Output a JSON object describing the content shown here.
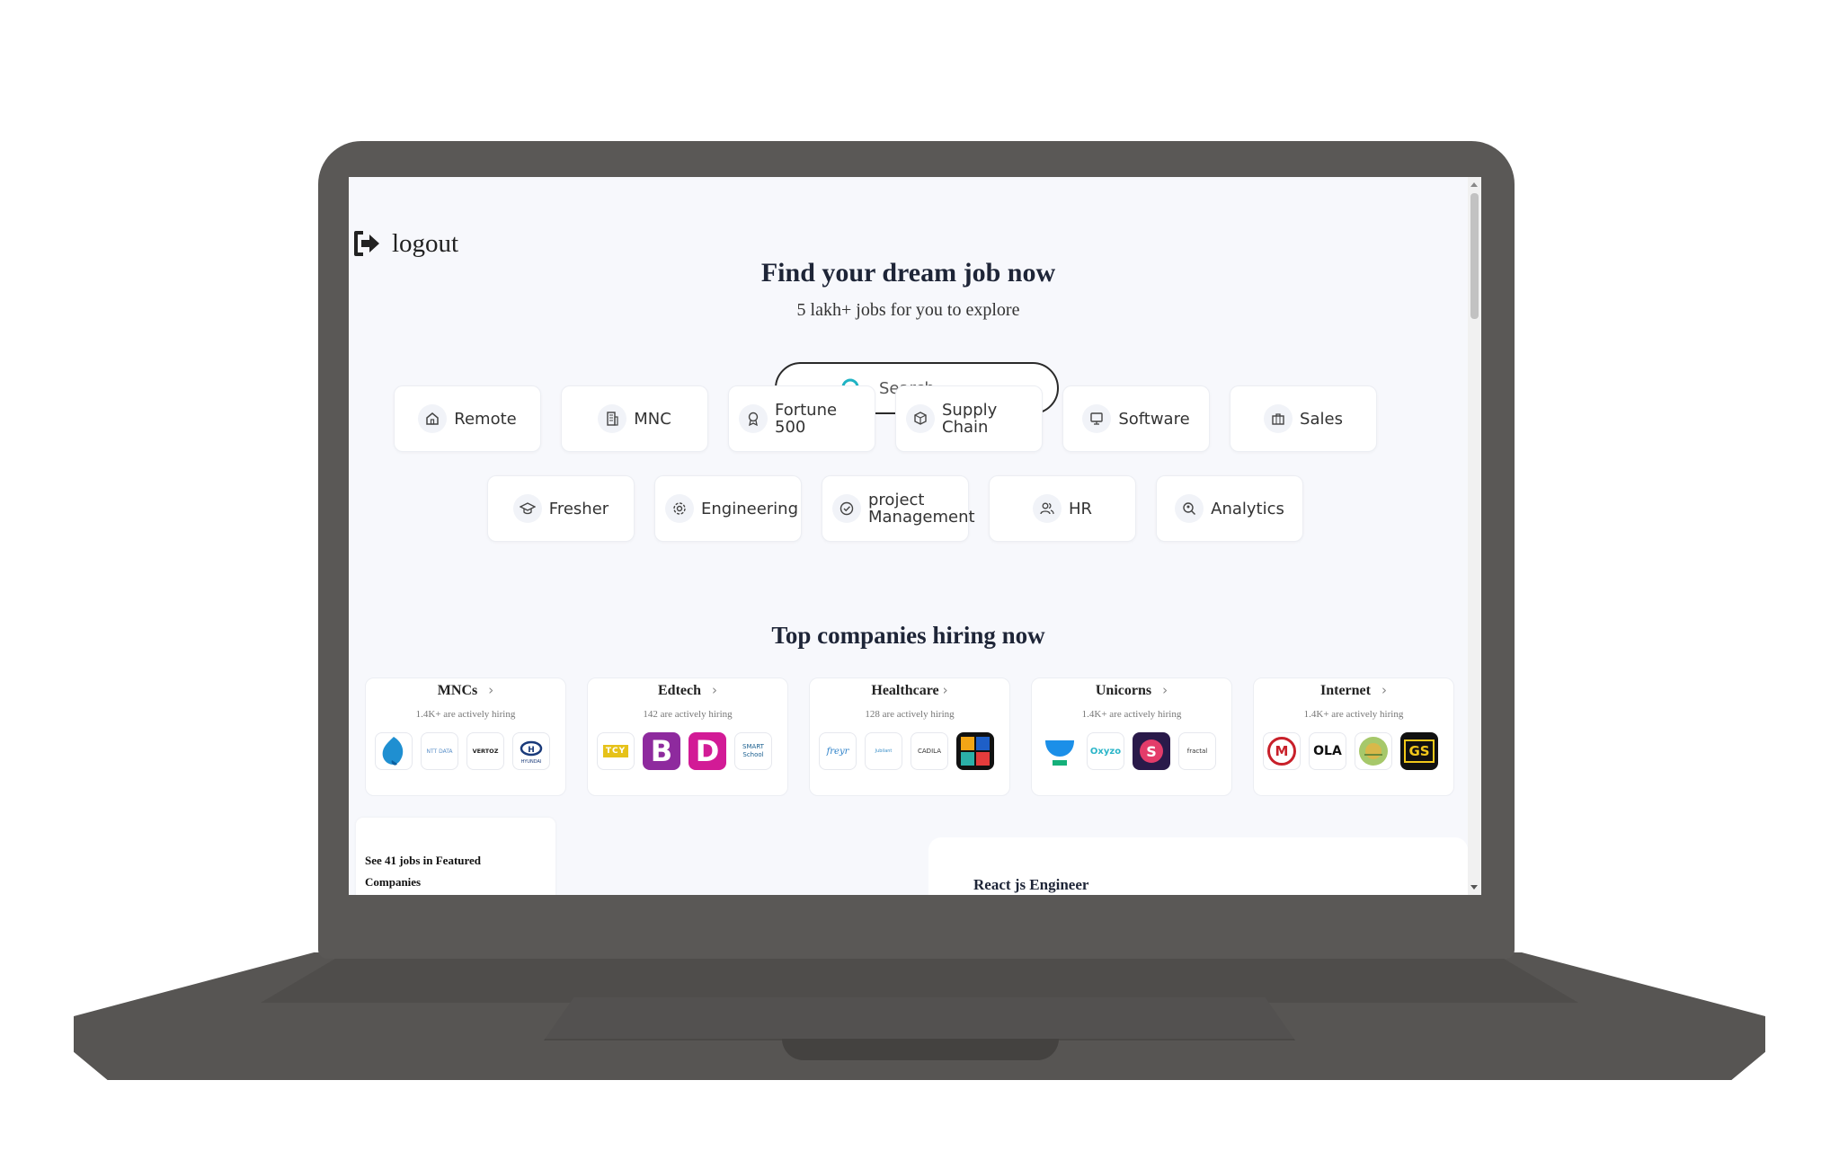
{
  "header": {
    "logout_label": "logout"
  },
  "hero": {
    "title": "Find your dream job now",
    "subtitle": "5 lakh+ jobs for you to explore",
    "search_placeholder": "Search"
  },
  "categories": [
    {
      "label": "Remote",
      "icon": "home-icon"
    },
    {
      "label": "MNC",
      "icon": "building-icon"
    },
    {
      "label": "Fortune 500",
      "icon": "award-icon"
    },
    {
      "label": "Supply Chain",
      "icon": "box-icon"
    },
    {
      "label": "Software",
      "icon": "monitor-icon"
    },
    {
      "label": "Sales",
      "icon": "briefcase-icon"
    },
    {
      "label": "Fresher",
      "icon": "graduation-cap-icon"
    },
    {
      "label": "Engineering",
      "icon": "gear-icon"
    },
    {
      "label": "project Management",
      "icon": "check-circle-icon"
    },
    {
      "label": "HR",
      "icon": "users-icon"
    },
    {
      "label": "Analytics",
      "icon": "analytics-icon"
    }
  ],
  "top_companies": {
    "title": "Top companies hiring now",
    "cards": [
      {
        "name": "MNCs",
        "subtitle": "1.4K+ are actively hiring",
        "logos": [
          "leaf-logo",
          "NTT DATA",
          "VERTOZ",
          "HYUNDAI"
        ]
      },
      {
        "name": "Edtech",
        "subtitle": "142 are actively hiring",
        "logos": [
          "TCY",
          "B",
          "D",
          "SMART School"
        ]
      },
      {
        "name": "Healthcare",
        "subtitle": "128 are actively hiring",
        "logos": [
          "freyr",
          "Jubilant",
          "CADILA",
          "cubes-logo"
        ]
      },
      {
        "name": "Unicorns",
        "subtitle": "1.4K+ are actively hiring",
        "logos": [
          "urban-logo",
          "Oxyzo",
          "S",
          "fractal"
        ]
      },
      {
        "name": "Internet",
        "subtitle": "1.4K+ are actively hiring",
        "logos": [
          "M",
          "OLA",
          "emblem-logo",
          "GS"
        ]
      }
    ]
  },
  "featured": {
    "text": "See 41 jobs in Featured Companies"
  },
  "job": {
    "title": "React js Engineer"
  },
  "colors": {
    "accent": "#1fb3c4",
    "text_dark": "#1e2537",
    "laptop": "#5a5856"
  }
}
